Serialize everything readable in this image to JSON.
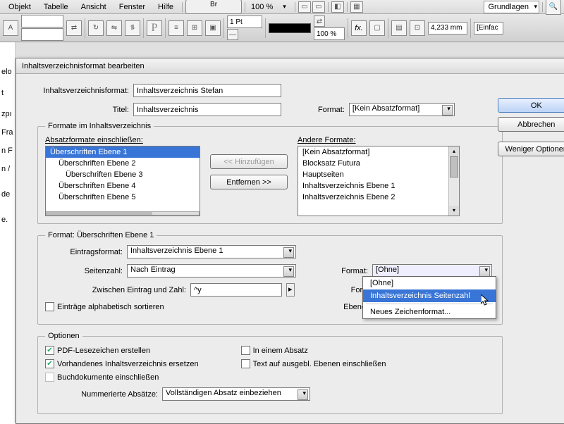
{
  "menubar": {
    "items": [
      "Objekt",
      "Tabelle",
      "Ansicht",
      "Fenster",
      "Hilfe"
    ],
    "br": "Br",
    "zoom": "100 %",
    "workspace": "Grundlagen"
  },
  "toolbar": {
    "pt": "1 Pt",
    "pct": "100 %",
    "mm": "4,233 mm",
    "einfac": "[Einfac"
  },
  "dialog": {
    "title": "Inhaltsverzeichnisformat bearbeiten",
    "format_label": "Inhaltsverzeichnisformat:",
    "format_value": "Inhaltsverzeichnis Stefan",
    "titel_label": "Titel:",
    "titel_value": "Inhaltsverzeichnis",
    "format2_label": "Format:",
    "format2_value": "[Kein Absatzformat]",
    "sidebuttons": {
      "ok": "OK",
      "cancel": "Abbrechen",
      "fewer": "Weniger Optionen"
    },
    "fs1": {
      "legend": "Formate im Inhaltsverzeichnis",
      "left_label": "Absatzformate einschließen:",
      "left_items": [
        "Überschriften Ebene 1",
        "Überschriften Ebene 2",
        "Überschriften Ebene 3",
        "Überschriften Ebene 4",
        "Überschriften Ebene 5"
      ],
      "add": "<< Hinzufügen",
      "remove": "Entfernen >>",
      "right_label": "Andere Formate:",
      "right_items": [
        "[Kein Absatzformat]",
        "Blocksatz Futura",
        "Hauptseiten",
        "Inhaltsverzeichnis Ebene 1",
        "Inhaltsverzeichnis Ebene 2"
      ]
    },
    "fs2": {
      "legend": "Format: Überschriften Ebene 1",
      "eintrag_label": "Eintragsformat:",
      "eintrag_value": "Inhaltsverzeichnis Ebene 1",
      "seiten_label": "Seitenzahl:",
      "seiten_value": "Nach Eintrag",
      "zwischen_label": "Zwischen Eintrag und Zahl:",
      "zwischen_value": "^y",
      "format_r1_label": "Format:",
      "format_r1_value": "[Ohne]",
      "format_r2_label": "Format:",
      "ebene_label": "Ebene:",
      "sort": "Einträge alphabetisch sortieren",
      "dropdown": {
        "opt1": "[Ohne]",
        "opt2": "Inhaltsverzeichnis Seitenzahl",
        "opt3": "Neues Zeichenformat..."
      }
    },
    "fs3": {
      "legend": "Optionen",
      "pdf": "PDF-Lesezeichen erstellen",
      "replace": "Vorhandenes Inhaltsverzeichnis ersetzen",
      "book": "Buchdokumente einschließen",
      "absatz": "In einem Absatz",
      "hidden": "Text auf ausgebl. Ebenen einschließen",
      "num_label": "Nummerierte Absätze:",
      "num_value": "Vollständigen Absatz einbeziehen"
    }
  }
}
